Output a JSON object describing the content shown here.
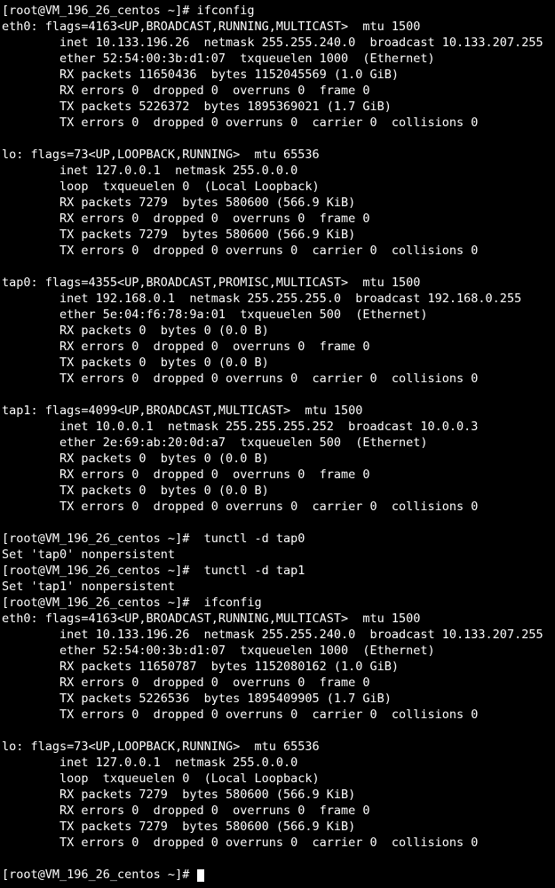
{
  "terminal": {
    "prompt": "[root@VM_196_26_centos ~]# ",
    "foreground_color": "#ffffff",
    "background_color": "#000000",
    "cursor": {
      "shape": "block",
      "color": "#ffffff"
    },
    "lines": [
      "[root@VM_196_26_centos ~]# ifconfig",
      "eth0: flags=4163<UP,BROADCAST,RUNNING,MULTICAST>  mtu 1500",
      "        inet 10.133.196.26  netmask 255.255.240.0  broadcast 10.133.207.255",
      "        ether 52:54:00:3b:d1:07  txqueuelen 1000  (Ethernet)",
      "        RX packets 11650436  bytes 1152045569 (1.0 GiB)",
      "        RX errors 0  dropped 0  overruns 0  frame 0",
      "        TX packets 5226372  bytes 1895369021 (1.7 GiB)",
      "        TX errors 0  dropped 0 overruns 0  carrier 0  collisions 0",
      "",
      "lo: flags=73<UP,LOOPBACK,RUNNING>  mtu 65536",
      "        inet 127.0.0.1  netmask 255.0.0.0",
      "        loop  txqueuelen 0  (Local Loopback)",
      "        RX packets 7279  bytes 580600 (566.9 KiB)",
      "        RX errors 0  dropped 0  overruns 0  frame 0",
      "        TX packets 7279  bytes 580600 (566.9 KiB)",
      "        TX errors 0  dropped 0 overruns 0  carrier 0  collisions 0",
      "",
      "tap0: flags=4355<UP,BROADCAST,PROMISC,MULTICAST>  mtu 1500",
      "        inet 192.168.0.1  netmask 255.255.255.0  broadcast 192.168.0.255",
      "        ether 5e:04:f6:78:9a:01  txqueuelen 500  (Ethernet)",
      "        RX packets 0  bytes 0 (0.0 B)",
      "        RX errors 0  dropped 0  overruns 0  frame 0",
      "        TX packets 0  bytes 0 (0.0 B)",
      "        TX errors 0  dropped 0 overruns 0  carrier 0  collisions 0",
      "",
      "tap1: flags=4099<UP,BROADCAST,MULTICAST>  mtu 1500",
      "        inet 10.0.0.1  netmask 255.255.255.252  broadcast 10.0.0.3",
      "        ether 2e:69:ab:20:0d:a7  txqueuelen 500  (Ethernet)",
      "        RX packets 0  bytes 0 (0.0 B)",
      "        RX errors 0  dropped 0  overruns 0  frame 0",
      "        TX packets 0  bytes 0 (0.0 B)",
      "        TX errors 0  dropped 0 overruns 0  carrier 0  collisions 0",
      "",
      "[root@VM_196_26_centos ~]#  tunctl -d tap0",
      "Set 'tap0' nonpersistent",
      "[root@VM_196_26_centos ~]#  tunctl -d tap1",
      "Set 'tap1' nonpersistent",
      "[root@VM_196_26_centos ~]#  ifconfig",
      "eth0: flags=4163<UP,BROADCAST,RUNNING,MULTICAST>  mtu 1500",
      "        inet 10.133.196.26  netmask 255.255.240.0  broadcast 10.133.207.255",
      "        ether 52:54:00:3b:d1:07  txqueuelen 1000  (Ethernet)",
      "        RX packets 11650787  bytes 1152080162 (1.0 GiB)",
      "        RX errors 0  dropped 0  overruns 0  frame 0",
      "        TX packets 5226536  bytes 1895409905 (1.7 GiB)",
      "        TX errors 0  dropped 0 overruns 0  carrier 0  collisions 0",
      "",
      "lo: flags=73<UP,LOOPBACK,RUNNING>  mtu 65536",
      "        inet 127.0.0.1  netmask 255.0.0.0",
      "        loop  txqueuelen 0  (Local Loopback)",
      "        RX packets 7279  bytes 580600 (566.9 KiB)",
      "        RX errors 0  dropped 0  overruns 0  frame 0",
      "        TX packets 7279  bytes 580600 (566.9 KiB)",
      "        TX errors 0  dropped 0 overruns 0  carrier 0  collisions 0",
      ""
    ],
    "final_prompt": "[root@VM_196_26_centos ~]# "
  }
}
